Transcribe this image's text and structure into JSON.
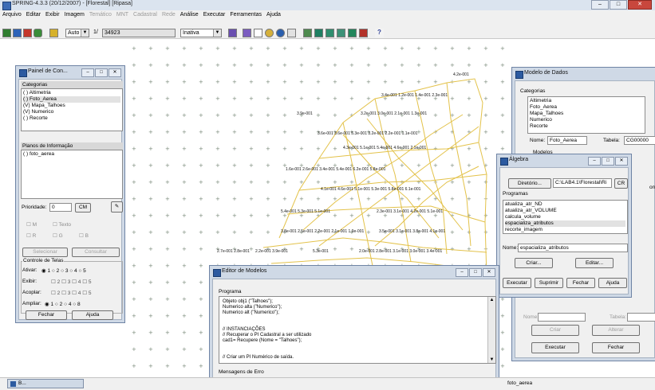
{
  "title_bar": {
    "title": "SPRING-4.3.3 (20/12/2007) - [Florestal] [Ripasa]",
    "minimize": "–",
    "maximize": "□",
    "close": "✕"
  },
  "menu": [
    {
      "label": "Arquivo",
      "enabled": true
    },
    {
      "label": "Editar",
      "enabled": true
    },
    {
      "label": "Exibir",
      "enabled": true
    },
    {
      "label": "Imagem",
      "enabled": true
    },
    {
      "label": "Temático",
      "enabled": false
    },
    {
      "label": "MNT",
      "enabled": false
    },
    {
      "label": "Cadastral",
      "enabled": false
    },
    {
      "label": "Rede",
      "enabled": false
    },
    {
      "label": "Análise",
      "enabled": true
    },
    {
      "label": "Executar",
      "enabled": true
    },
    {
      "label": "Ferramentas",
      "enabled": true
    },
    {
      "label": "Ajuda",
      "enabled": true
    }
  ],
  "toolbar": {
    "scale_mode": "Auto",
    "scale_prefix": "1/",
    "scale_value": "34923",
    "layer_state": "Inativa",
    "help_icon": "?"
  },
  "map": {
    "grid_labels": [
      "4.2e-001",
      "3.4e-001 1.2e-001 1.4e-001 2.3e-001",
      "3.9e-001",
      "3.2e-001 3.0e-001 2.1e-001 1.3e-001",
      "3.6e-001 3.6e-001 5.3e-001 3.2e-001 2.2e-001 1.1e-001",
      "4.3e-001 5.1e-001 5.4e-001 4.6e-001 2.1e-001",
      "1.6e-001 2.6e-001 3.4e-001 5.4e-001 6.2e-001 5.8e-001",
      "4.1e-001 4.6e-001 5.1e-001 5.3e-001 5.8e-001 6.1e-001",
      "5.4e-001 5.3e-001 5.1e-001",
      "2.3e-001 3.1e-001 4.2e-001 5.1e-001",
      "3.8e-001 2.5e-001 2.2e-001 2.1e-001 1.9e-001",
      "3.5e-001 3.1e-001 3.8e-001 4.1e-001",
      "2.7e-001 2.8e-001",
      "2.2e-001 3.9e-001",
      "5.3e-001",
      "2.0e-001 2.8e-001 3.1e-001 3.0e-001 3.4e-001"
    ]
  },
  "painel": {
    "title": "Painel de Con...",
    "categorias_header": "Categorias",
    "categorias": [
      {
        "label": "( ) Altimetria",
        "selected": false
      },
      {
        "label": "( ) Foto_Aerea",
        "selected": true
      },
      {
        "label": "(V) Mapa_Talhoes",
        "selected": false
      },
      {
        "label": "(V) Numerico",
        "selected": false
      },
      {
        "label": "( ) Recorte",
        "selected": false
      }
    ],
    "planos_header": "Planos de Informação",
    "planos": [
      {
        "label": "( ) foto_aerea"
      }
    ],
    "prioridade_label": "Prioridade:",
    "prioridade_value": "0",
    "cm_button": "CM",
    "check_m": "M",
    "check_texto": "Texto",
    "check_r": "R",
    "check_g": "G",
    "check_b": "B",
    "selecionar": "Selecionar",
    "consultar": "Consultar",
    "controle_telas": "Controle de Telas",
    "ativar_label": "Ativar:",
    "exibir_label": "Exibir:",
    "acoplar_label": "Acoplar:",
    "ampliar_label": "Ampliar:",
    "tela_options": [
      "1",
      "2",
      "3",
      "4",
      "5"
    ],
    "ampliar_options": [
      "1",
      "2",
      "4",
      "8"
    ],
    "fechar": "Fechar",
    "ajuda": "Ajuda"
  },
  "modelo_dados": {
    "title": "Modelo de Dados",
    "categorias_label": "Categorias",
    "categorias": [
      "Altimetria",
      "Foto_Aerea",
      "Mapa_Talhoes",
      "Numerico",
      "Recorte"
    ],
    "nome_label": "Nome:",
    "nome_value": "Foto_Aerea",
    "tabela_label": "Tabela:",
    "tabela_value": "CG00000",
    "nome2_label": "Nome:",
    "tabela2_label": "Tabela:",
    "criar": "Criar",
    "alterar": "Alterar",
    "executar": "Executar",
    "fechar": "Fechar",
    "modelos_label": "Modelos",
    "final_label": "onal"
  },
  "algebra": {
    "title": "Álgebra",
    "diretorio_button": "Diretório...",
    "diretorio_path": "C:\\LAB4.1\\Florestal\\Ri",
    "cr_button": "CR",
    "programas_label": "Programas",
    "programas": [
      {
        "label": "atualiza_atr_ND",
        "selected": false
      },
      {
        "label": "atualiza_atr_VOLUME",
        "selected": false
      },
      {
        "label": "calcula_volume",
        "selected": false
      },
      {
        "label": "espacializa_atributos",
        "selected": true
      },
      {
        "label": "recorte_imagem",
        "selected": false
      }
    ],
    "nome_label": "Nome:",
    "nome_value": "espacializa_atributos",
    "criar": "Criar...",
    "editar": "Editar...",
    "executar": "Executar",
    "suprimir": "Suprimir",
    "fechar": "Fechar",
    "ajuda": "Ajuda"
  },
  "editor": {
    "title": "Editor de Modelos",
    "programa_label": "Programa",
    "code_lines": [
      "Objeto obj1     (\"Talhoes\");",
      "Numerico alta   (\"Numerico\");",
      "Numerico alt    (\"Numerico\");",
      "",
      "",
      "// INSTANCIAÇÕES",
      "// Recuperar o PI Cadastral a ser utilizado",
      "cad1= Recupere (Nome = \"Talhoes\");",
      "",
      "",
      "// Criar um PI Numérico de saída."
    ],
    "mensagens_label": "Mensagens de Erro"
  },
  "taskbar": {
    "minimized_window": "B...",
    "status_text": "foto_aerea"
  },
  "colors": {
    "window_frame": "#cfd9e6",
    "grid_lines": "#e3c24a",
    "dialog_bg": "#f0f0f0"
  }
}
